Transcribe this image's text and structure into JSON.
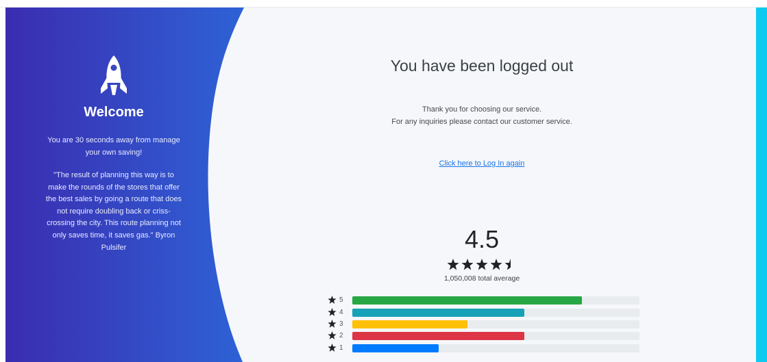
{
  "sidebar": {
    "welcome": "Welcome",
    "intro": "You are 30 seconds away from manage your own saving!",
    "quote": "\"The result of planning this way is to make the rounds of the stores that offer the best sales by going a route that does not require doubling back or criss-crossing the city. This route planning not only saves time, it saves gas.\" Byron Pulsifer",
    "icon": "rocket-icon"
  },
  "main": {
    "title": "You have been logged out",
    "thanks_line1": "Thank you for choosing our service.",
    "thanks_line2": "For any inquiries please contact our customer service.",
    "relogin_link": "Click here to Log In again"
  },
  "rating": {
    "score": "4.5",
    "stars": 4.5,
    "total": "1,050,008 total average",
    "bars": [
      {
        "label": "5",
        "fraction": 0.8,
        "color": "#28a745"
      },
      {
        "label": "4",
        "fraction": 0.6,
        "color": "#17a2b8"
      },
      {
        "label": "3",
        "fraction": 0.4,
        "color": "#ffc107"
      },
      {
        "label": "2",
        "fraction": 0.6,
        "color": "#dc3545"
      },
      {
        "label": "1",
        "fraction": 0.3,
        "color": "#007bff"
      }
    ]
  },
  "colors": {
    "gradient_start": "#3d2fb5",
    "gradient_end": "#2f63d8",
    "accent_edge": "#0dcaf0"
  }
}
